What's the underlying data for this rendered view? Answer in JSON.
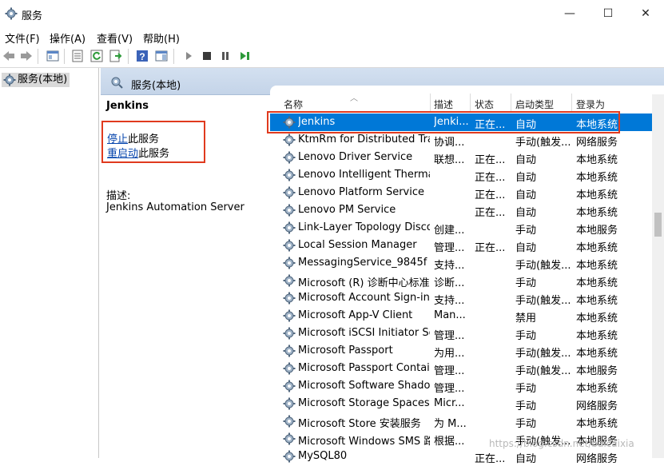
{
  "window": {
    "title": "服务",
    "minimize": "—",
    "maximize": "☐",
    "close": "✕"
  },
  "menu": [
    "文件(F)",
    "操作(A)",
    "查看(V)",
    "帮助(H)"
  ],
  "tree": {
    "root": "服务(本地)"
  },
  "panel": {
    "header": "服务(本地)"
  },
  "detail": {
    "service_name": "Jenkins",
    "stop_link": "停止",
    "stop_suffix": "此服务",
    "restart_link": "重启动",
    "restart_suffix": "此服务",
    "desc_label": "描述:",
    "desc_text": "Jenkins Automation Server"
  },
  "columns": {
    "name": "名称",
    "desc": "描述",
    "status": "状态",
    "startup": "启动类型",
    "logon": "登录为"
  },
  "services": [
    {
      "name": "Jenkins",
      "desc": "Jenki...",
      "status": "正在...",
      "startup": "自动",
      "logon": "本地系统"
    },
    {
      "name": "KtmRm for Distributed Tra...",
      "desc": "协调...",
      "status": "",
      "startup": "手动(触发...",
      "logon": "网络服务"
    },
    {
      "name": "Lenovo Driver Service",
      "desc": "联想...",
      "status": "正在...",
      "startup": "自动",
      "logon": "本地系统"
    },
    {
      "name": "Lenovo Intelligent Thermal...",
      "desc": "",
      "status": "正在...",
      "startup": "自动",
      "logon": "本地系统"
    },
    {
      "name": "Lenovo Platform Service",
      "desc": "",
      "status": "正在...",
      "startup": "自动",
      "logon": "本地系统"
    },
    {
      "name": "Lenovo PM Service",
      "desc": "",
      "status": "正在...",
      "startup": "自动",
      "logon": "本地系统"
    },
    {
      "name": "Link-Layer Topology Disco...",
      "desc": "创建...",
      "status": "",
      "startup": "手动",
      "logon": "本地服务"
    },
    {
      "name": "Local Session Manager",
      "desc": "管理...",
      "status": "正在...",
      "startup": "自动",
      "logon": "本地系统"
    },
    {
      "name": "MessagingService_9845f",
      "desc": "支持...",
      "status": "",
      "startup": "手动(触发...",
      "logon": "本地系统"
    },
    {
      "name": "Microsoft (R) 诊断中心标准...",
      "desc": "诊断...",
      "status": "",
      "startup": "手动",
      "logon": "本地系统"
    },
    {
      "name": "Microsoft Account Sign-in ...",
      "desc": "支持...",
      "status": "",
      "startup": "手动(触发...",
      "logon": "本地系统"
    },
    {
      "name": "Microsoft App-V Client",
      "desc": "Man...",
      "status": "",
      "startup": "禁用",
      "logon": "本地系统"
    },
    {
      "name": "Microsoft iSCSI Initiator Ser...",
      "desc": "管理...",
      "status": "",
      "startup": "手动",
      "logon": "本地系统"
    },
    {
      "name": "Microsoft Passport",
      "desc": "为用...",
      "status": "",
      "startup": "手动(触发...",
      "logon": "本地系统"
    },
    {
      "name": "Microsoft Passport Container",
      "desc": "管理...",
      "status": "",
      "startup": "手动(触发...",
      "logon": "本地服务"
    },
    {
      "name": "Microsoft Software Shado...",
      "desc": "管理...",
      "status": "",
      "startup": "手动",
      "logon": "本地系统"
    },
    {
      "name": "Microsoft Storage Spaces S...",
      "desc": "Micr...",
      "status": "",
      "startup": "手动",
      "logon": "网络服务"
    },
    {
      "name": "Microsoft Store 安装服务",
      "desc": "为 M...",
      "status": "",
      "startup": "手动",
      "logon": "本地系统"
    },
    {
      "name": "Microsoft Windows SMS 路...",
      "desc": "根据...",
      "status": "",
      "startup": "手动(触发...",
      "logon": "本地服务"
    },
    {
      "name": "MySQL80",
      "desc": "",
      "status": "正在...",
      "startup": "自动",
      "logon": "网络服务"
    }
  ],
  "watermark": "https://blog.csdn.net/baicaixia",
  "colors": {
    "selection": "#0078d7",
    "highlight_box": "#e03a1e",
    "link": "#0645ad"
  }
}
